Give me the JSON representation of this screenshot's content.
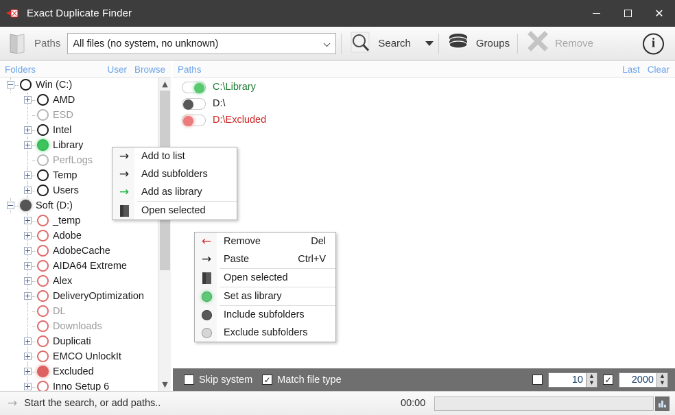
{
  "window": {
    "title": "Exact Duplicate Finder",
    "icon": "app-icon",
    "minimize_label": "Minimize",
    "maximize_label": "Maximize",
    "close_label": "Close"
  },
  "toolbar": {
    "folder_icon": "folder-icon",
    "paths_label": "Paths",
    "filter_value": "All files (no system, no unknown)",
    "filter_placeholder": "All files (no system, no unknown)",
    "search_label": "Search",
    "search_icon": "magnifier-icon",
    "search_dropdown_icon": "caret-down-icon",
    "groups_label": "Groups",
    "groups_icon": "database-icon",
    "remove_label": "Remove",
    "remove_icon": "x-icon",
    "info_label": "i",
    "info_icon": "info-icon"
  },
  "folders_panel": {
    "title": "Folders",
    "links": [
      "User",
      "Browse"
    ],
    "scroll": {
      "up_icon": "chevron-up-icon",
      "down_icon": "chevron-down-icon"
    },
    "items": [
      {
        "label": "Win (C:)",
        "depth": 0,
        "expander": "minus",
        "bullet": "outline-black",
        "dim": false
      },
      {
        "label": "AMD",
        "depth": 1,
        "expander": "plus",
        "bullet": "outline-black",
        "dim": false
      },
      {
        "label": "ESD",
        "depth": 1,
        "expander": "none",
        "bullet": "outline-gray",
        "dim": true
      },
      {
        "label": "Intel",
        "depth": 1,
        "expander": "plus",
        "bullet": "outline-black",
        "dim": false
      },
      {
        "label": "Library",
        "depth": 1,
        "expander": "plus",
        "bullet": "filled-green",
        "dim": false
      },
      {
        "label": "PerfLogs",
        "depth": 1,
        "expander": "none",
        "bullet": "outline-gray",
        "dim": true
      },
      {
        "label": "Temp",
        "depth": 1,
        "expander": "plus",
        "bullet": "outline-black",
        "dim": false
      },
      {
        "label": "Users",
        "depth": 1,
        "expander": "plus",
        "bullet": "outline-black",
        "dim": false
      },
      {
        "label": "Soft (D:)",
        "depth": 0,
        "expander": "minus",
        "bullet": "filled-dark",
        "dim": false
      },
      {
        "label": "_temp",
        "depth": 1,
        "expander": "plus",
        "bullet": "outline-red",
        "dim": false
      },
      {
        "label": "Adobe",
        "depth": 1,
        "expander": "plus",
        "bullet": "outline-red",
        "dim": false
      },
      {
        "label": "AdobeCache",
        "depth": 1,
        "expander": "plus",
        "bullet": "outline-red",
        "dim": false
      },
      {
        "label": "AIDA64 Extreme",
        "depth": 1,
        "expander": "plus",
        "bullet": "outline-red",
        "dim": false
      },
      {
        "label": "Alex",
        "depth": 1,
        "expander": "plus",
        "bullet": "outline-red",
        "dim": false
      },
      {
        "label": "DeliveryOptimization",
        "depth": 1,
        "expander": "plus",
        "bullet": "outline-red",
        "dim": false
      },
      {
        "label": "DL",
        "depth": 1,
        "expander": "none",
        "bullet": "outline-red",
        "dim": true
      },
      {
        "label": "Downloads",
        "depth": 1,
        "expander": "none",
        "bullet": "outline-red",
        "dim": true
      },
      {
        "label": "Duplicati",
        "depth": 1,
        "expander": "plus",
        "bullet": "outline-red",
        "dim": false
      },
      {
        "label": "EMCO UnlockIt",
        "depth": 1,
        "expander": "plus",
        "bullet": "outline-red",
        "dim": false
      },
      {
        "label": "Excluded",
        "depth": 1,
        "expander": "plus",
        "bullet": "filled-red",
        "dim": false
      },
      {
        "label": "Inno Setup 6",
        "depth": 1,
        "expander": "plus",
        "bullet": "outline-red",
        "dim": false
      }
    ]
  },
  "paths_panel": {
    "title": "Paths",
    "links": [
      "Last",
      "Clear"
    ],
    "items": [
      {
        "label": "C:\\Library",
        "toggle": "on",
        "color": "#1f7a34",
        "knob": "green"
      },
      {
        "label": "D:\\",
        "toggle": "off",
        "color": "#1a1a1a",
        "knob": "dark"
      },
      {
        "label": "D:\\Excluded",
        "toggle": "off",
        "color": "#cc2222",
        "knob": "red"
      }
    ]
  },
  "options_bar": {
    "skip_system": {
      "label": "Skip system",
      "checked": false
    },
    "match_file_type": {
      "label": "Match file type",
      "checked": true
    },
    "min_spinner": {
      "checked": false,
      "value": "10"
    },
    "max_spinner": {
      "checked": true,
      "value": "2000"
    }
  },
  "status_bar": {
    "arrow_icon": "arrow-right-icon",
    "message": "Start the search, or add paths..",
    "elapsed": "00:00",
    "progress_value": 0,
    "chart_icon": "bar-chart-icon"
  },
  "context_menu_folders": {
    "items": [
      {
        "label": "Add to list",
        "icon": "arrow-right-icon",
        "shortcut": "",
        "sep_after": false
      },
      {
        "label": "Add subfolders",
        "icon": "arrow-right-icon",
        "shortcut": "",
        "sep_after": false
      },
      {
        "label": "Add as library",
        "icon": "arrow-right-green-icon",
        "shortcut": "",
        "sep_after": true
      },
      {
        "label": "Open selected",
        "icon": "book-icon",
        "shortcut": "",
        "sep_after": false
      }
    ]
  },
  "context_menu_paths": {
    "items": [
      {
        "label": "Remove",
        "icon": "arrow-left-red-icon",
        "shortcut": "Del",
        "sep_after": false
      },
      {
        "label": "Paste",
        "icon": "arrow-right-icon",
        "shortcut": "Ctrl+V",
        "sep_after": true
      },
      {
        "label": "Open selected",
        "icon": "book-icon",
        "shortcut": "",
        "sep_after": true
      },
      {
        "label": "Set as library",
        "icon": "dot-green-icon",
        "shortcut": "",
        "sep_after": true
      },
      {
        "label": "Include subfolders",
        "icon": "dot-dark-icon",
        "shortcut": "",
        "sep_after": false
      },
      {
        "label": "Exclude subfolders",
        "icon": "dot-light-icon",
        "shortcut": "",
        "sep_after": false
      }
    ]
  }
}
